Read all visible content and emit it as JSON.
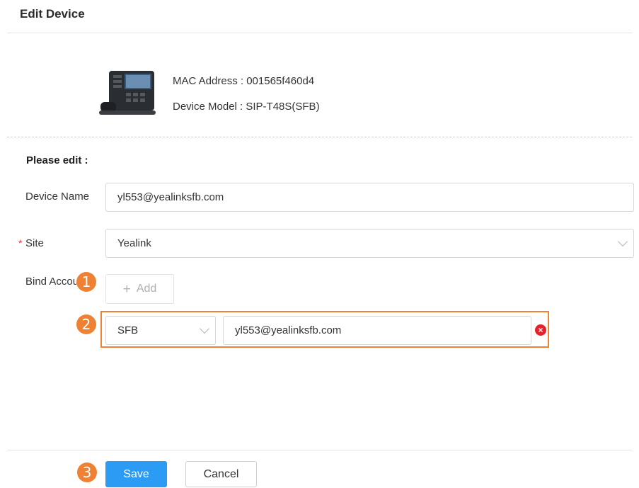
{
  "header": {
    "title": "Edit Device"
  },
  "device": {
    "mac_label": "MAC Address : 001565f460d4",
    "model_label": "Device Model : SIP-T48S(SFB)",
    "image": "desk-phone-image"
  },
  "form": {
    "section_label": "Please edit :",
    "device_name": {
      "label": "Device Name",
      "value": "yl553@yealinksfb.com"
    },
    "site": {
      "required_mark": "*",
      "label": "Site",
      "value": "Yealink"
    },
    "bind_account": {
      "label": "Bind Accou",
      "add_label": "Add",
      "add_icon": "+",
      "account_type": "SFB",
      "account_value": "yl553@yealinksfb.com",
      "remove_icon": "×"
    }
  },
  "footer": {
    "save_label": "Save",
    "cancel_label": "Cancel"
  },
  "annotations": {
    "step1": "1",
    "step2": "2",
    "step3": "3",
    "color": "#ee8133"
  },
  "colors": {
    "primary": "#2b9bf4",
    "danger": "#e8202a",
    "highlight": "#ee8133"
  }
}
